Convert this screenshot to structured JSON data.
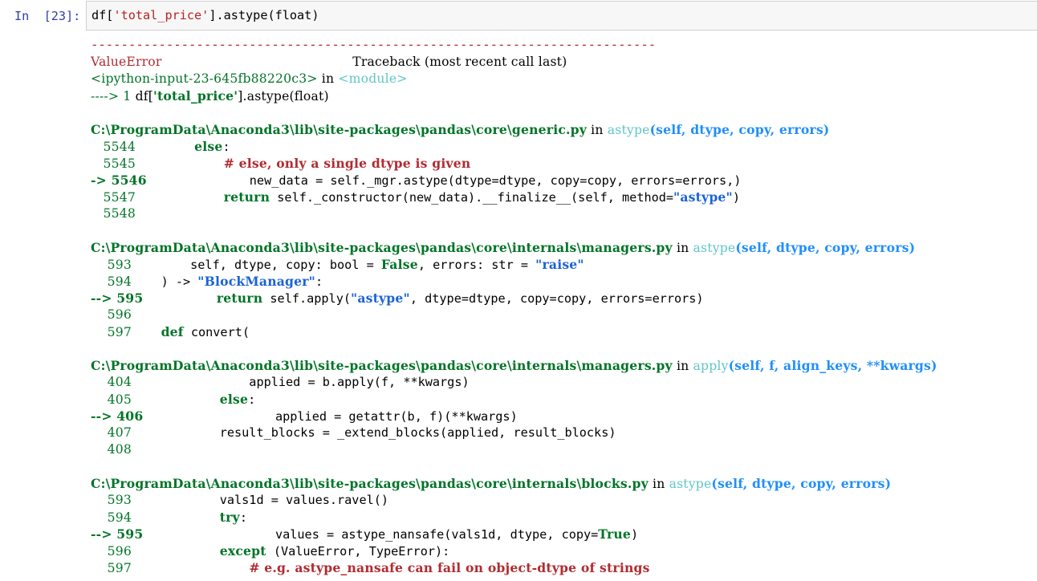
{
  "cell": {
    "prompt": "In  [23]:",
    "code_prefix": "df[",
    "code_string": "'total_price'",
    "code_suffix": "].astype(float)"
  },
  "traceback": {
    "separator": "---------------------------------------------------------------------------",
    "error_type": "ValueError",
    "header_gap": "                          ",
    "header_label": "Traceback (most recent call last)",
    "input_name": "<ipython-input-23-645fb88220c3>",
    "in_word": " in ",
    "module": "<module>",
    "arrow1": "----> 1 ",
    "line1_a": "df[",
    "line1_b": "'total_price'",
    "line1_c": "].astype(float)",
    "frames": [
      {
        "path": "C:\\ProgramData\\Anaconda3\\lib\\site-packages\\pandas\\core\\generic.py",
        "in": " in ",
        "func": "astype",
        "args": "(self, dtype, copy, errors)",
        "lines": [
          {
            "num": "   5544",
            "code": "        else:"
          },
          {
            "num": "   5545",
            "code": "            # else, only a single dtype is given"
          },
          {
            "num": "-> 5546",
            "code": "              new_data = self._mgr.astype(dtype=dtype, copy=copy, errors=errors,)"
          },
          {
            "num": "   5547",
            "code": "            return self._constructor(new_data).__finalize__(self, method=\"astype\")"
          },
          {
            "num": "   5548",
            "code": ""
          }
        ]
      },
      {
        "path": "C:\\ProgramData\\Anaconda3\\lib\\site-packages\\pandas\\core\\internals\\managers.py",
        "in": " in ",
        "func": "astype",
        "args": "(self, dtype, copy, errors)",
        "lines": [
          {
            "num": "    593",
            "code": "        self, dtype, copy: bool = False, errors: str = \"raise\""
          },
          {
            "num": "    594",
            "code": "    ) -> \"BlockManager\":"
          },
          {
            "num": "--> 595",
            "code": "          return self.apply(\"astype\", dtype=dtype, copy=copy, errors=errors)"
          },
          {
            "num": "    596",
            "code": ""
          },
          {
            "num": "    597",
            "code": "    def convert("
          }
        ]
      },
      {
        "path": "C:\\ProgramData\\Anaconda3\\lib\\site-packages\\pandas\\core\\internals\\managers.py",
        "in": " in ",
        "func": "apply",
        "args": "(self, f, align_keys, **kwargs)",
        "lines": [
          {
            "num": "    404",
            "code": "                applied = b.apply(f, **kwargs)"
          },
          {
            "num": "    405",
            "code": "            else:"
          },
          {
            "num": "--> 406",
            "code": "                  applied = getattr(b, f)(**kwargs)"
          },
          {
            "num": "    407",
            "code": "            result_blocks = _extend_blocks(applied, result_blocks)"
          },
          {
            "num": "    408",
            "code": ""
          }
        ]
      },
      {
        "path": "C:\\ProgramData\\Anaconda3\\lib\\site-packages\\pandas\\core\\internals\\blocks.py",
        "in": " in ",
        "func": "astype",
        "args": "(self, dtype, copy, errors)",
        "lines": [
          {
            "num": "    593",
            "code": "            vals1d = values.ravel()"
          },
          {
            "num": "    594",
            "code": "            try:"
          },
          {
            "num": "--> 595",
            "code": "                  values = astype_nansafe(vals1d, dtype, copy=True)"
          },
          {
            "num": "    596",
            "code": "            except (ValueError, TypeError):"
          },
          {
            "num": "    597",
            "code": "                # e.g. astype_nansafe can fail on object-dtype of strings"
          }
        ]
      }
    ]
  }
}
